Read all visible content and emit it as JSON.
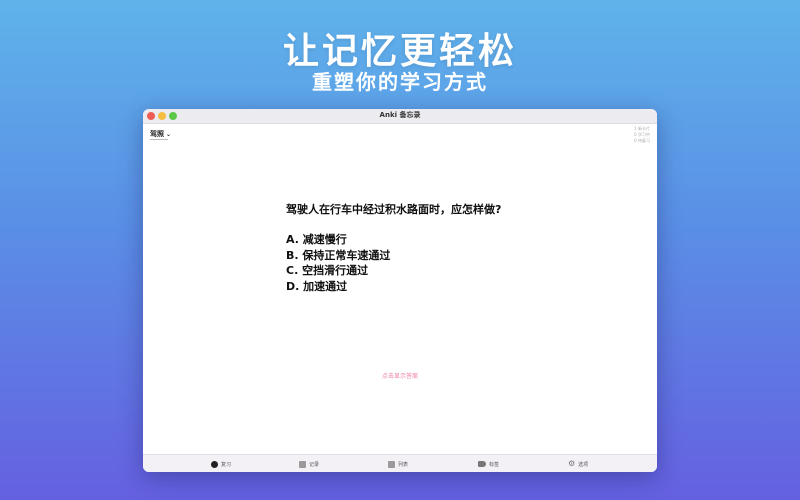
{
  "promo": {
    "headline": "让记忆更轻松",
    "subheadline": "重塑你的学习方式"
  },
  "window": {
    "title": "Anki 备忘录"
  },
  "deck": {
    "selected": "驾照"
  },
  "stats": {
    "line1": "1  新卡片",
    "line2": "0  学习中",
    "line3": "0  待复习"
  },
  "card": {
    "question": "驾驶人在行车中经过积水路面时，应怎样做?",
    "options": [
      "A. 减速慢行",
      "B. 保持正常车速通过",
      "C. 空挡滑行通过",
      "D. 加速通过"
    ],
    "reveal_hint": "点击显示答案"
  },
  "tabs": [
    {
      "label": "复习",
      "icon": "review-icon",
      "selected": true
    },
    {
      "label": "记录",
      "icon": "record-icon"
    },
    {
      "label": "列表",
      "icon": "list-icon"
    },
    {
      "label": "标签",
      "icon": "tag-icon"
    },
    {
      "label": "选项",
      "icon": "gear-icon"
    }
  ],
  "colors": {
    "reveal_hint": "#ef7fa8",
    "close": "#ee5d55",
    "minimize": "#f5bd42",
    "maximize": "#5ec84a"
  }
}
